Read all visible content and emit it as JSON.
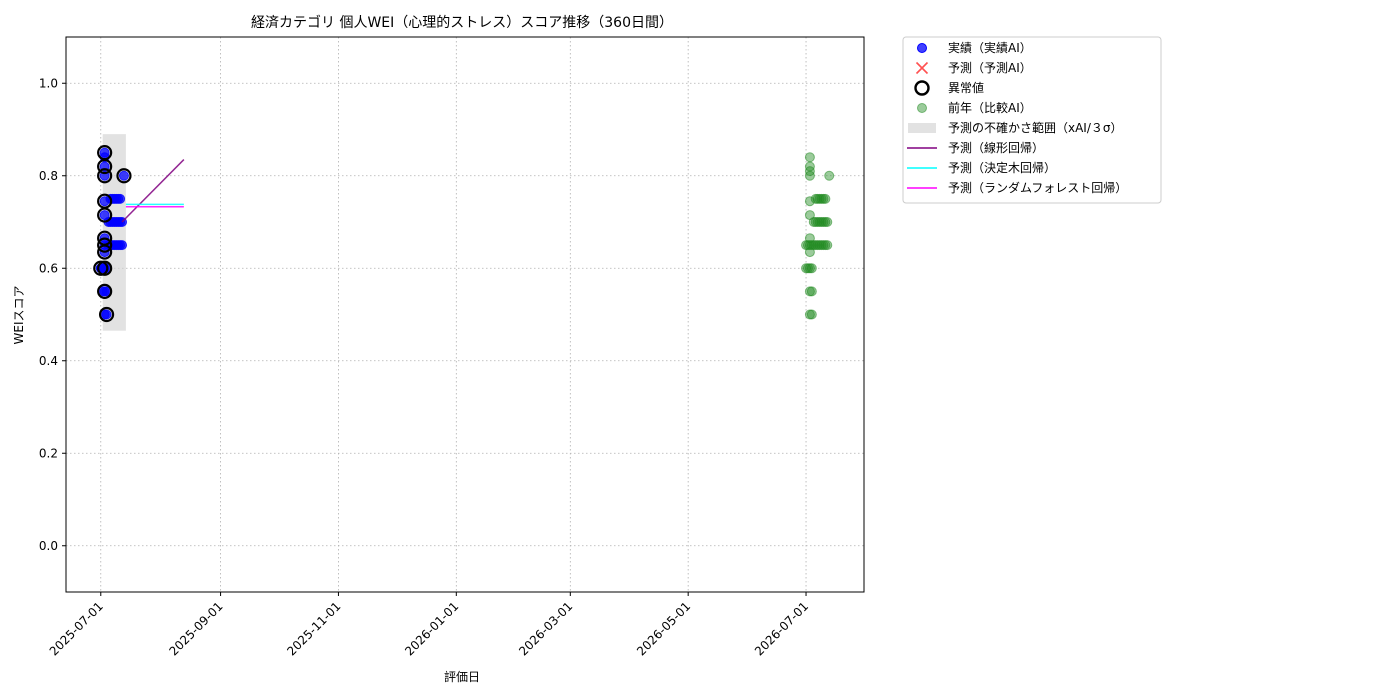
{
  "chart_data": {
    "type": "scatter",
    "title": "経済カテゴリ 個人WEI（心理的ストレス）スコア推移（360日間）",
    "xlabel": "評価日",
    "ylabel": "WEIスコア",
    "xlim": [
      "2025-06-13",
      "2026-07-31"
    ],
    "ylim": [
      -0.1,
      1.1
    ],
    "x_ticks": [
      "2025-07-01",
      "2025-09-01",
      "2025-11-01",
      "2026-01-01",
      "2026-03-01",
      "2026-05-01",
      "2026-07-01"
    ],
    "y_ticks": [
      0.0,
      0.2,
      0.4,
      0.6,
      0.8,
      1.0
    ],
    "y_tick_labels": [
      "0.0",
      "0.2",
      "0.4",
      "0.6",
      "0.8",
      "1.0"
    ],
    "grid": true,
    "legend_position": "outside upper right",
    "series": [
      {
        "name": "実績（実績AI）",
        "kind": "scatter",
        "color": "#0000ff",
        "points": [
          [
            "2025-07-01",
            0.6
          ],
          [
            "2025-07-01",
            0.6
          ],
          [
            "2025-07-02",
            0.6
          ],
          [
            "2025-07-03",
            0.6
          ],
          [
            "2025-07-03",
            0.6
          ],
          [
            "2025-07-04",
            0.6
          ],
          [
            "2025-07-02",
            0.55
          ],
          [
            "2025-07-03",
            0.55
          ],
          [
            "2025-07-04",
            0.55
          ],
          [
            "2025-07-03",
            0.5
          ],
          [
            "2025-07-04",
            0.5
          ],
          [
            "2025-07-03",
            0.85
          ],
          [
            "2025-07-03",
            0.84
          ],
          [
            "2025-07-03",
            0.82
          ],
          [
            "2025-07-03",
            0.8
          ],
          [
            "2025-07-03",
            0.745
          ],
          [
            "2025-07-03",
            0.715
          ],
          [
            "2025-07-03",
            0.665
          ],
          [
            "2025-07-03",
            0.65
          ],
          [
            "2025-07-03",
            0.635
          ],
          [
            "2025-07-05",
            0.7
          ],
          [
            "2025-07-06",
            0.7
          ],
          [
            "2025-07-07",
            0.7
          ],
          [
            "2025-07-08",
            0.7
          ],
          [
            "2025-07-09",
            0.7
          ],
          [
            "2025-07-10",
            0.7
          ],
          [
            "2025-07-11",
            0.7
          ],
          [
            "2025-07-12",
            0.7
          ],
          [
            "2025-07-05",
            0.65
          ],
          [
            "2025-07-06",
            0.65
          ],
          [
            "2025-07-07",
            0.65
          ],
          [
            "2025-07-08",
            0.65
          ],
          [
            "2025-07-09",
            0.65
          ],
          [
            "2025-07-10",
            0.65
          ],
          [
            "2025-07-11",
            0.65
          ],
          [
            "2025-07-12",
            0.65
          ],
          [
            "2025-07-06",
            0.75
          ],
          [
            "2025-07-07",
            0.75
          ],
          [
            "2025-07-08",
            0.75
          ],
          [
            "2025-07-09",
            0.75
          ],
          [
            "2025-07-10",
            0.75
          ],
          [
            "2025-07-11",
            0.75
          ],
          [
            "2025-07-13",
            0.8
          ]
        ]
      },
      {
        "name": "予測（予測AI）",
        "kind": "marker-x",
        "color": "#ff3333",
        "points": []
      },
      {
        "name": "異常値",
        "kind": "ring",
        "color": "#000000",
        "points": [
          [
            "2025-07-01",
            0.6
          ],
          [
            "2025-07-03",
            0.6
          ],
          [
            "2025-07-03",
            0.55
          ],
          [
            "2025-07-04",
            0.5
          ],
          [
            "2025-07-03",
            0.85
          ],
          [
            "2025-07-03",
            0.82
          ],
          [
            "2025-07-03",
            0.8
          ],
          [
            "2025-07-03",
            0.745
          ],
          [
            "2025-07-03",
            0.715
          ],
          [
            "2025-07-03",
            0.665
          ],
          [
            "2025-07-03",
            0.65
          ],
          [
            "2025-07-03",
            0.635
          ],
          [
            "2025-07-13",
            0.8
          ]
        ]
      },
      {
        "name": "前年（比較AI）",
        "kind": "scatter-faded",
        "color": "#228b22",
        "points": [
          [
            "2026-07-01",
            0.65
          ],
          [
            "2026-07-02",
            0.65
          ],
          [
            "2026-07-03",
            0.65
          ],
          [
            "2026-07-04",
            0.65
          ],
          [
            "2026-07-01",
            0.6
          ],
          [
            "2026-07-02",
            0.6
          ],
          [
            "2026-07-03",
            0.6
          ],
          [
            "2026-07-04",
            0.6
          ],
          [
            "2026-07-03",
            0.55
          ],
          [
            "2026-07-04",
            0.55
          ],
          [
            "2026-07-03",
            0.5
          ],
          [
            "2026-07-04",
            0.5
          ],
          [
            "2026-07-03",
            0.84
          ],
          [
            "2026-07-03",
            0.82
          ],
          [
            "2026-07-03",
            0.81
          ],
          [
            "2026-07-03",
            0.8
          ],
          [
            "2026-07-03",
            0.745
          ],
          [
            "2026-07-03",
            0.715
          ],
          [
            "2026-07-03",
            0.665
          ],
          [
            "2026-07-03",
            0.635
          ],
          [
            "2026-07-05",
            0.7
          ],
          [
            "2026-07-06",
            0.7
          ],
          [
            "2026-07-07",
            0.7
          ],
          [
            "2026-07-08",
            0.7
          ],
          [
            "2026-07-09",
            0.7
          ],
          [
            "2026-07-10",
            0.7
          ],
          [
            "2026-07-11",
            0.7
          ],
          [
            "2026-07-12",
            0.7
          ],
          [
            "2026-07-05",
            0.65
          ],
          [
            "2026-07-06",
            0.65
          ],
          [
            "2026-07-07",
            0.65
          ],
          [
            "2026-07-08",
            0.65
          ],
          [
            "2026-07-09",
            0.65
          ],
          [
            "2026-07-10",
            0.65
          ],
          [
            "2026-07-11",
            0.65
          ],
          [
            "2026-07-12",
            0.65
          ],
          [
            "2026-07-06",
            0.75
          ],
          [
            "2026-07-07",
            0.75
          ],
          [
            "2026-07-08",
            0.75
          ],
          [
            "2026-07-09",
            0.75
          ],
          [
            "2026-07-10",
            0.75
          ],
          [
            "2026-07-11",
            0.75
          ],
          [
            "2026-07-13",
            0.8
          ]
        ]
      },
      {
        "name": "予測の不確かさ範囲（xAI/３σ）",
        "kind": "band",
        "color": "#d3d3d3",
        "x": [
          "2025-07-02",
          "2025-07-14"
        ],
        "y": [
          0.465,
          0.89
        ]
      },
      {
        "name": "予測（線形回帰）",
        "kind": "line",
        "color": "#800080",
        "points": [
          [
            "2025-07-12",
            0.7
          ],
          [
            "2025-08-13",
            0.835
          ]
        ]
      },
      {
        "name": "予測（決定木回帰）",
        "kind": "line",
        "color": "#00ffff",
        "points": [
          [
            "2025-07-14",
            0.738
          ],
          [
            "2025-08-13",
            0.738
          ]
        ]
      },
      {
        "name": "予測（ランダムフォレスト回帰）",
        "kind": "line",
        "color": "#ff00ff",
        "points": [
          [
            "2025-07-14",
            0.733
          ],
          [
            "2025-08-13",
            0.733
          ]
        ]
      }
    ]
  }
}
